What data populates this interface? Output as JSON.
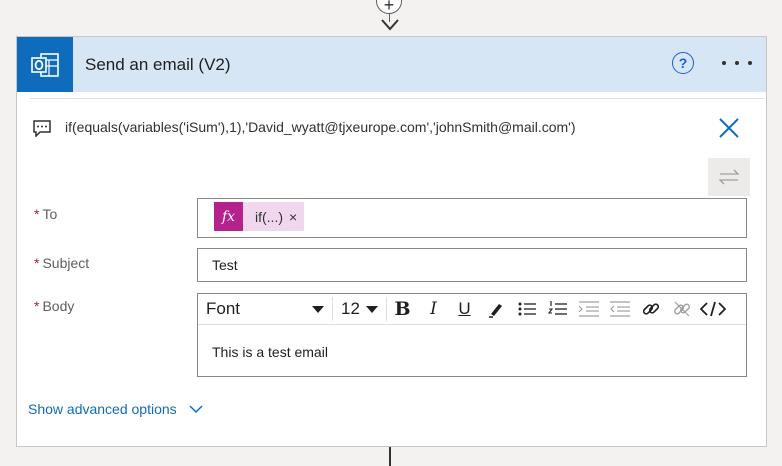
{
  "flow": {
    "insert_step_glyph": "+"
  },
  "card": {
    "title": "Send an email (V2)",
    "help_glyph": "?",
    "brand_color": "#0f6cbd",
    "header_bg": "#d6e6f5"
  },
  "expression": {
    "text": "if(equals(variables('iSum'),1),'David_wyatt@tjxeurope.com','johnSmith@mail.com')"
  },
  "fields": {
    "to": {
      "required_mark": "*",
      "label": "To",
      "token_icon": "fx",
      "token_label": "if(...)",
      "token_remove": "×"
    },
    "subject": {
      "required_mark": "*",
      "label": "Subject",
      "value": "Test"
    },
    "body": {
      "required_mark": "*",
      "label": "Body",
      "font": "Font",
      "font_size": "12",
      "value": "This is a test email"
    }
  },
  "toolbar": {
    "bold": "B",
    "italic": "I",
    "underline": "U",
    "icons": [
      "pen-icon",
      "bullet-list-icon",
      "numbered-list-icon",
      "decrease-indent-icon",
      "increase-indent-icon",
      "link-icon",
      "unlink-icon",
      "code-view-icon"
    ]
  },
  "advanced": {
    "label": "Show advanced options"
  }
}
